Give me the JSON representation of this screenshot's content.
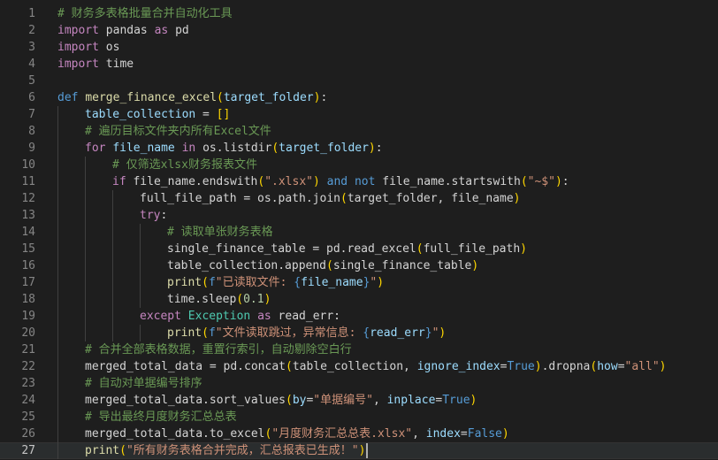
{
  "editor": {
    "current_line": 27,
    "lines": [
      {
        "n": "1",
        "indent": 0,
        "tokens": [
          {
            "c": "cm",
            "t": "# 财务多表格批量合并自动化工具"
          }
        ]
      },
      {
        "n": "2",
        "indent": 0,
        "tokens": [
          {
            "c": "ctl",
            "t": "import"
          },
          {
            "c": "pl",
            "t": " pandas "
          },
          {
            "c": "ctl",
            "t": "as"
          },
          {
            "c": "pl",
            "t": " pd"
          }
        ]
      },
      {
        "n": "3",
        "indent": 0,
        "tokens": [
          {
            "c": "ctl",
            "t": "import"
          },
          {
            "c": "pl",
            "t": " os"
          }
        ]
      },
      {
        "n": "4",
        "indent": 0,
        "tokens": [
          {
            "c": "ctl",
            "t": "import"
          },
          {
            "c": "pl",
            "t": " time"
          }
        ]
      },
      {
        "n": "5",
        "indent": 0,
        "tokens": []
      },
      {
        "n": "6",
        "indent": 0,
        "tokens": [
          {
            "c": "kw",
            "t": "def"
          },
          {
            "c": "pl",
            "t": " "
          },
          {
            "c": "fn",
            "t": "merge_finance_excel"
          },
          {
            "c": "b1",
            "t": "("
          },
          {
            "c": "param",
            "t": "target_folder"
          },
          {
            "c": "b1",
            "t": ")"
          },
          {
            "c": "pl",
            "t": ":"
          }
        ]
      },
      {
        "n": "7",
        "indent": 1,
        "tokens": [
          {
            "c": "var",
            "t": "table_collection"
          },
          {
            "c": "pl",
            "t": " = "
          },
          {
            "c": "b1",
            "t": "[]"
          }
        ]
      },
      {
        "n": "8",
        "indent": 1,
        "tokens": [
          {
            "c": "cm",
            "t": "# 遍历目标文件夹内所有Excel文件"
          }
        ]
      },
      {
        "n": "9",
        "indent": 1,
        "tokens": [
          {
            "c": "ctl",
            "t": "for"
          },
          {
            "c": "pl",
            "t": " "
          },
          {
            "c": "var",
            "t": "file_name"
          },
          {
            "c": "pl",
            "t": " "
          },
          {
            "c": "ctl",
            "t": "in"
          },
          {
            "c": "pl",
            "t": " os.listdir"
          },
          {
            "c": "b1",
            "t": "("
          },
          {
            "c": "var",
            "t": "target_folder"
          },
          {
            "c": "b1",
            "t": ")"
          },
          {
            "c": "pl",
            "t": ":"
          }
        ]
      },
      {
        "n": "10",
        "indent": 2,
        "tokens": [
          {
            "c": "cm",
            "t": "# 仅筛选xlsx财务报表文件"
          }
        ]
      },
      {
        "n": "11",
        "indent": 2,
        "tokens": [
          {
            "c": "ctl",
            "t": "if"
          },
          {
            "c": "pl",
            "t": " file_name.endswith"
          },
          {
            "c": "b1",
            "t": "("
          },
          {
            "c": "str",
            "t": "\".xlsx\""
          },
          {
            "c": "b1",
            "t": ")"
          },
          {
            "c": "pl",
            "t": " "
          },
          {
            "c": "kw",
            "t": "and"
          },
          {
            "c": "pl",
            "t": " "
          },
          {
            "c": "kw",
            "t": "not"
          },
          {
            "c": "pl",
            "t": " file_name.startswith"
          },
          {
            "c": "b1",
            "t": "("
          },
          {
            "c": "str",
            "t": "\"~$\""
          },
          {
            "c": "b1",
            "t": ")"
          },
          {
            "c": "pl",
            "t": ":"
          }
        ]
      },
      {
        "n": "12",
        "indent": 3,
        "tokens": [
          {
            "c": "pl",
            "t": "full_file_path = os.path.join"
          },
          {
            "c": "b1",
            "t": "("
          },
          {
            "c": "pl",
            "t": "target_folder, file_name"
          },
          {
            "c": "b1",
            "t": ")"
          }
        ]
      },
      {
        "n": "13",
        "indent": 3,
        "tokens": [
          {
            "c": "ctl",
            "t": "try"
          },
          {
            "c": "pl",
            "t": ":"
          }
        ]
      },
      {
        "n": "14",
        "indent": 4,
        "tokens": [
          {
            "c": "cm",
            "t": "# 读取单张财务表格"
          }
        ]
      },
      {
        "n": "15",
        "indent": 4,
        "tokens": [
          {
            "c": "pl",
            "t": "single_finance_table = pd.read_excel"
          },
          {
            "c": "b1",
            "t": "("
          },
          {
            "c": "pl",
            "t": "full_file_path"
          },
          {
            "c": "b1",
            "t": ")"
          }
        ]
      },
      {
        "n": "16",
        "indent": 4,
        "tokens": [
          {
            "c": "pl",
            "t": "table_collection.append"
          },
          {
            "c": "b1",
            "t": "("
          },
          {
            "c": "pl",
            "t": "single_finance_table"
          },
          {
            "c": "b1",
            "t": ")"
          }
        ]
      },
      {
        "n": "17",
        "indent": 4,
        "tokens": [
          {
            "c": "fn",
            "t": "print"
          },
          {
            "c": "b1",
            "t": "("
          },
          {
            "c": "kw",
            "t": "f"
          },
          {
            "c": "str",
            "t": "\"已读取文件: "
          },
          {
            "c": "kw",
            "t": "{"
          },
          {
            "c": "var",
            "t": "file_name"
          },
          {
            "c": "kw",
            "t": "}"
          },
          {
            "c": "str",
            "t": "\""
          },
          {
            "c": "b1",
            "t": ")"
          }
        ]
      },
      {
        "n": "18",
        "indent": 4,
        "tokens": [
          {
            "c": "pl",
            "t": "time.sleep"
          },
          {
            "c": "b1",
            "t": "("
          },
          {
            "c": "num",
            "t": "0.1"
          },
          {
            "c": "b1",
            "t": ")"
          }
        ]
      },
      {
        "n": "19",
        "indent": 3,
        "tokens": [
          {
            "c": "ctl",
            "t": "except"
          },
          {
            "c": "pl",
            "t": " "
          },
          {
            "c": "cls",
            "t": "Exception"
          },
          {
            "c": "pl",
            "t": " "
          },
          {
            "c": "ctl",
            "t": "as"
          },
          {
            "c": "pl",
            "t": " read_err:"
          }
        ]
      },
      {
        "n": "20",
        "indent": 4,
        "tokens": [
          {
            "c": "fn",
            "t": "print"
          },
          {
            "c": "b1",
            "t": "("
          },
          {
            "c": "kw",
            "t": "f"
          },
          {
            "c": "str",
            "t": "\"文件读取跳过，异常信息: "
          },
          {
            "c": "kw",
            "t": "{"
          },
          {
            "c": "var",
            "t": "read_err"
          },
          {
            "c": "kw",
            "t": "}"
          },
          {
            "c": "str",
            "t": "\""
          },
          {
            "c": "b1",
            "t": ")"
          }
        ]
      },
      {
        "n": "21",
        "indent": 1,
        "tokens": [
          {
            "c": "cm",
            "t": "# 合并全部表格数据，重置行索引，自动剔除空白行"
          }
        ]
      },
      {
        "n": "22",
        "indent": 1,
        "tokens": [
          {
            "c": "pl",
            "t": "merged_total_data = pd.concat"
          },
          {
            "c": "b1",
            "t": "("
          },
          {
            "c": "pl",
            "t": "table_collection, "
          },
          {
            "c": "var",
            "t": "ignore_index"
          },
          {
            "c": "pl",
            "t": "="
          },
          {
            "c": "kw",
            "t": "True"
          },
          {
            "c": "b1",
            "t": ")"
          },
          {
            "c": "pl",
            "t": ".dropna"
          },
          {
            "c": "b1",
            "t": "("
          },
          {
            "c": "var",
            "t": "how"
          },
          {
            "c": "pl",
            "t": "="
          },
          {
            "c": "str",
            "t": "\"all\""
          },
          {
            "c": "b1",
            "t": ")"
          }
        ]
      },
      {
        "n": "23",
        "indent": 1,
        "tokens": [
          {
            "c": "cm",
            "t": "# 自动对单据编号排序"
          }
        ]
      },
      {
        "n": "24",
        "indent": 1,
        "tokens": [
          {
            "c": "pl",
            "t": "merged_total_data.sort_values"
          },
          {
            "c": "b1",
            "t": "("
          },
          {
            "c": "var",
            "t": "by"
          },
          {
            "c": "pl",
            "t": "="
          },
          {
            "c": "str",
            "t": "\"单据编号\""
          },
          {
            "c": "pl",
            "t": ", "
          },
          {
            "c": "var",
            "t": "inplace"
          },
          {
            "c": "pl",
            "t": "="
          },
          {
            "c": "kw",
            "t": "True"
          },
          {
            "c": "b1",
            "t": ")"
          }
        ]
      },
      {
        "n": "25",
        "indent": 1,
        "tokens": [
          {
            "c": "cm",
            "t": "# 导出最终月度财务汇总总表"
          }
        ]
      },
      {
        "n": "26",
        "indent": 1,
        "tokens": [
          {
            "c": "pl",
            "t": "merged_total_data.to_excel"
          },
          {
            "c": "b1",
            "t": "("
          },
          {
            "c": "str",
            "t": "\"月度财务汇总总表.xlsx\""
          },
          {
            "c": "pl",
            "t": ", "
          },
          {
            "c": "var",
            "t": "index"
          },
          {
            "c": "pl",
            "t": "="
          },
          {
            "c": "kw",
            "t": "False"
          },
          {
            "c": "b1",
            "t": ")"
          }
        ]
      },
      {
        "n": "27",
        "indent": 1,
        "tokens": [
          {
            "c": "fn",
            "t": "print"
          },
          {
            "c": "b1",
            "t": "("
          },
          {
            "c": "str",
            "t": "\"所有财务表格合并完成，汇总报表已生成！\""
          },
          {
            "c": "b1",
            "t": ")"
          }
        ]
      }
    ]
  }
}
